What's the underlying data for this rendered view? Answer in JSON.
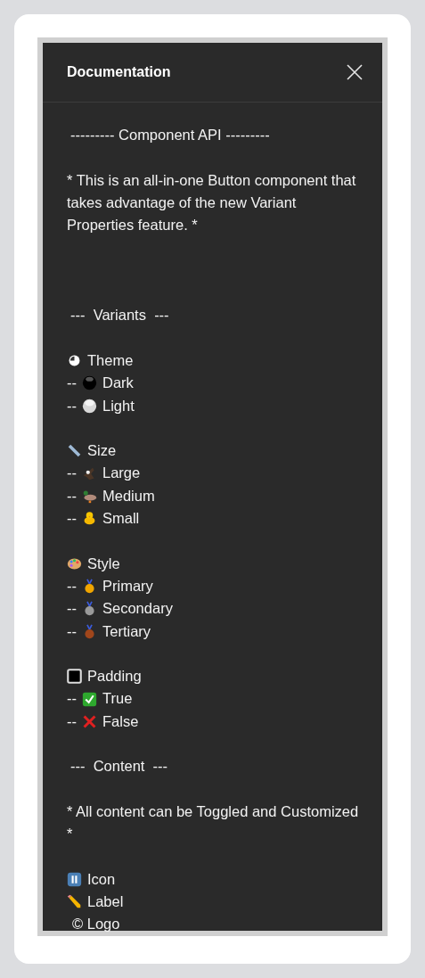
{
  "panel": {
    "title": "Documentation"
  },
  "lines": [
    {
      "kind": "heading",
      "text": "--------- Component API ---------"
    },
    {
      "kind": "gap"
    },
    {
      "kind": "paragraph",
      "text": "* This is an all-in-one Button component that takes advantage of the new Variant Properties feature. *"
    },
    {
      "kind": "gap"
    },
    {
      "kind": "gap"
    },
    {
      "kind": "gap"
    },
    {
      "kind": "heading",
      "text": "---  Variants  ---"
    },
    {
      "kind": "gap"
    },
    {
      "kind": "group",
      "text": "Theme"
    },
    {
      "kind": "item",
      "dash": "--",
      "text": "Dark"
    },
    {
      "kind": "item",
      "dash": "--",
      "text": "Light"
    },
    {
      "kind": "gap"
    },
    {
      "kind": "group",
      "text": "Size"
    },
    {
      "kind": "item",
      "dash": "--",
      "text": "Large"
    },
    {
      "kind": "item",
      "dash": "--",
      "text": "Medium"
    },
    {
      "kind": "item",
      "dash": "--",
      "text": "Small"
    },
    {
      "kind": "gap"
    },
    {
      "kind": "group",
      "text": "Style"
    },
    {
      "kind": "item",
      "dash": "--",
      "text": "Primary"
    },
    {
      "kind": "item",
      "dash": "--",
      "text": "Secondary"
    },
    {
      "kind": "item",
      "dash": "--",
      "text": "Tertiary"
    },
    {
      "kind": "gap"
    },
    {
      "kind": "group",
      "text": "Padding"
    },
    {
      "kind": "item",
      "dash": "--",
      "text": "True"
    },
    {
      "kind": "item",
      "dash": "--",
      "text": "False"
    },
    {
      "kind": "gap"
    },
    {
      "kind": "heading",
      "text": "---  Content  ---"
    },
    {
      "kind": "gap"
    },
    {
      "kind": "paragraph",
      "text": "* All content can be Toggled and Customized *"
    },
    {
      "kind": "gap"
    },
    {
      "kind": "group",
      "text": "Icon"
    },
    {
      "kind": "group",
      "text": "Label"
    },
    {
      "kind": "plain",
      "text": "© Logo"
    }
  ]
}
